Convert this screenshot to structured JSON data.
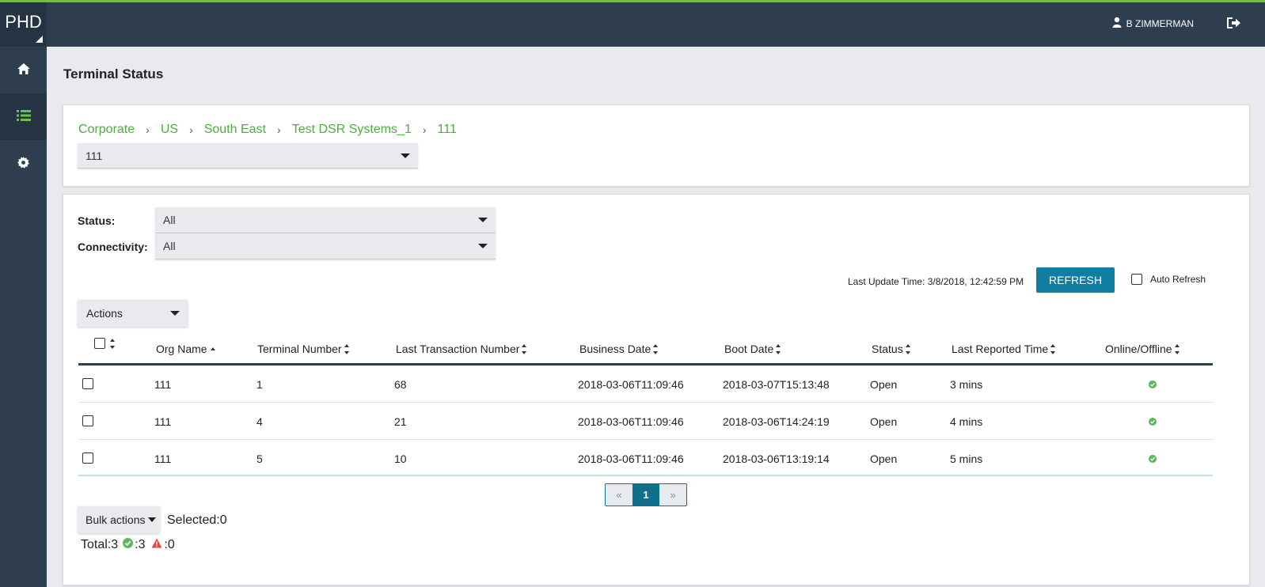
{
  "app": {
    "logo": "PHD",
    "user_name": "B ZIMMERMAN"
  },
  "colors": {
    "accent_green": "#4caf3e",
    "primary_blue": "#0f7ea1",
    "nav_bg": "#2e3e4f",
    "warning_red": "#e04848"
  },
  "sidebar": {
    "items": [
      {
        "icon": "home-icon",
        "active": false
      },
      {
        "icon": "list-icon",
        "active": true
      },
      {
        "icon": "gear-icon",
        "active": false
      }
    ]
  },
  "page": {
    "title": "Terminal Status"
  },
  "breadcrumb": [
    "Corporate",
    "US",
    "South East",
    "Test DSR Systems_1",
    "111"
  ],
  "org_select": {
    "value": "111"
  },
  "filters": {
    "status_label": "Status:",
    "status_value": "All",
    "connectivity_label": "Connectivity:",
    "connectivity_value": "All"
  },
  "toolbar": {
    "last_update": "Last Update Time: 3/8/2018, 12:42:59 PM",
    "refresh_label": "REFRESH",
    "auto_refresh_label": "Auto Refresh",
    "actions_label": "Actions"
  },
  "table": {
    "columns": [
      "Org Name",
      "Terminal Number",
      "Last Transaction Number",
      "Business Date",
      "Boot Date",
      "Status",
      "Last Reported Time",
      "Online/Offline"
    ],
    "rows": [
      {
        "org": "111",
        "terminal": "1",
        "last_txn": "68",
        "business_date": "2018-03-06T11:09:46",
        "boot_date": "2018-03-07T15:13:48",
        "status": "Open",
        "reported": "3 mins",
        "online": true
      },
      {
        "org": "111",
        "terminal": "4",
        "last_txn": "21",
        "business_date": "2018-03-06T11:09:46",
        "boot_date": "2018-03-06T14:24:19",
        "status": "Open",
        "reported": "4 mins",
        "online": true
      },
      {
        "org": "111",
        "terminal": "5",
        "last_txn": "10",
        "business_date": "2018-03-06T11:09:46",
        "boot_date": "2018-03-06T13:19:14",
        "status": "Open",
        "reported": "5 mins",
        "online": true
      }
    ]
  },
  "pagination": {
    "prev": "«",
    "current": "1",
    "next": "»"
  },
  "footer": {
    "bulk_label": "Bulk actions",
    "selected_text": "Selected:0",
    "total_text": "Total:3",
    "online_count": ":3",
    "offline_count": ":0"
  }
}
